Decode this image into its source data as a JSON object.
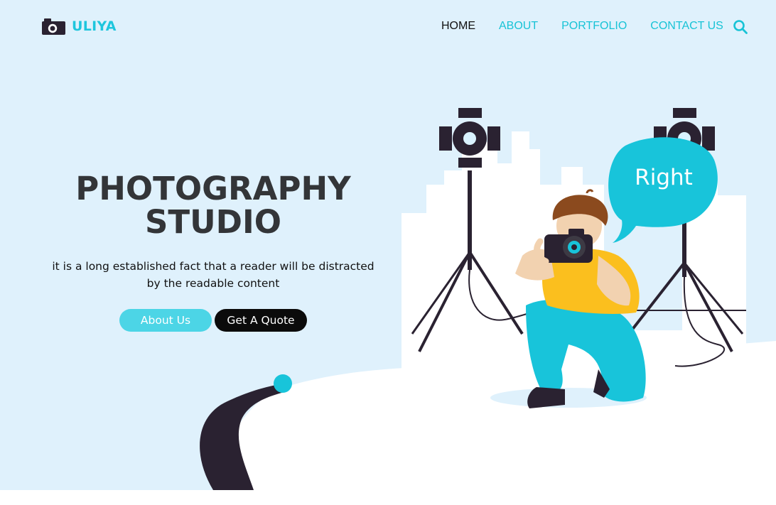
{
  "brand": {
    "name": "ULIYA"
  },
  "nav": {
    "items": [
      {
        "label": "HOME",
        "active": true
      },
      {
        "label": "ABOUT",
        "active": false
      },
      {
        "label": "PORTFOLIO",
        "active": false
      },
      {
        "label": "CONTACT US",
        "active": false
      }
    ],
    "search_icon": "search-icon"
  },
  "hero": {
    "title_line1": "PHOTOGRAPHY",
    "title_line2": "STUDIO",
    "description_line1": "it is a long established fact that a reader will be distracted",
    "description_line2": "by the readable content",
    "primary_button": "About Us",
    "secondary_button": "Get A Quote"
  },
  "illustration": {
    "speech_bubble_text": "Right"
  },
  "colors": {
    "accent": "#1ec6dd",
    "background": "#dff1fc",
    "dark": "#2a2231",
    "title": "#333538"
  }
}
